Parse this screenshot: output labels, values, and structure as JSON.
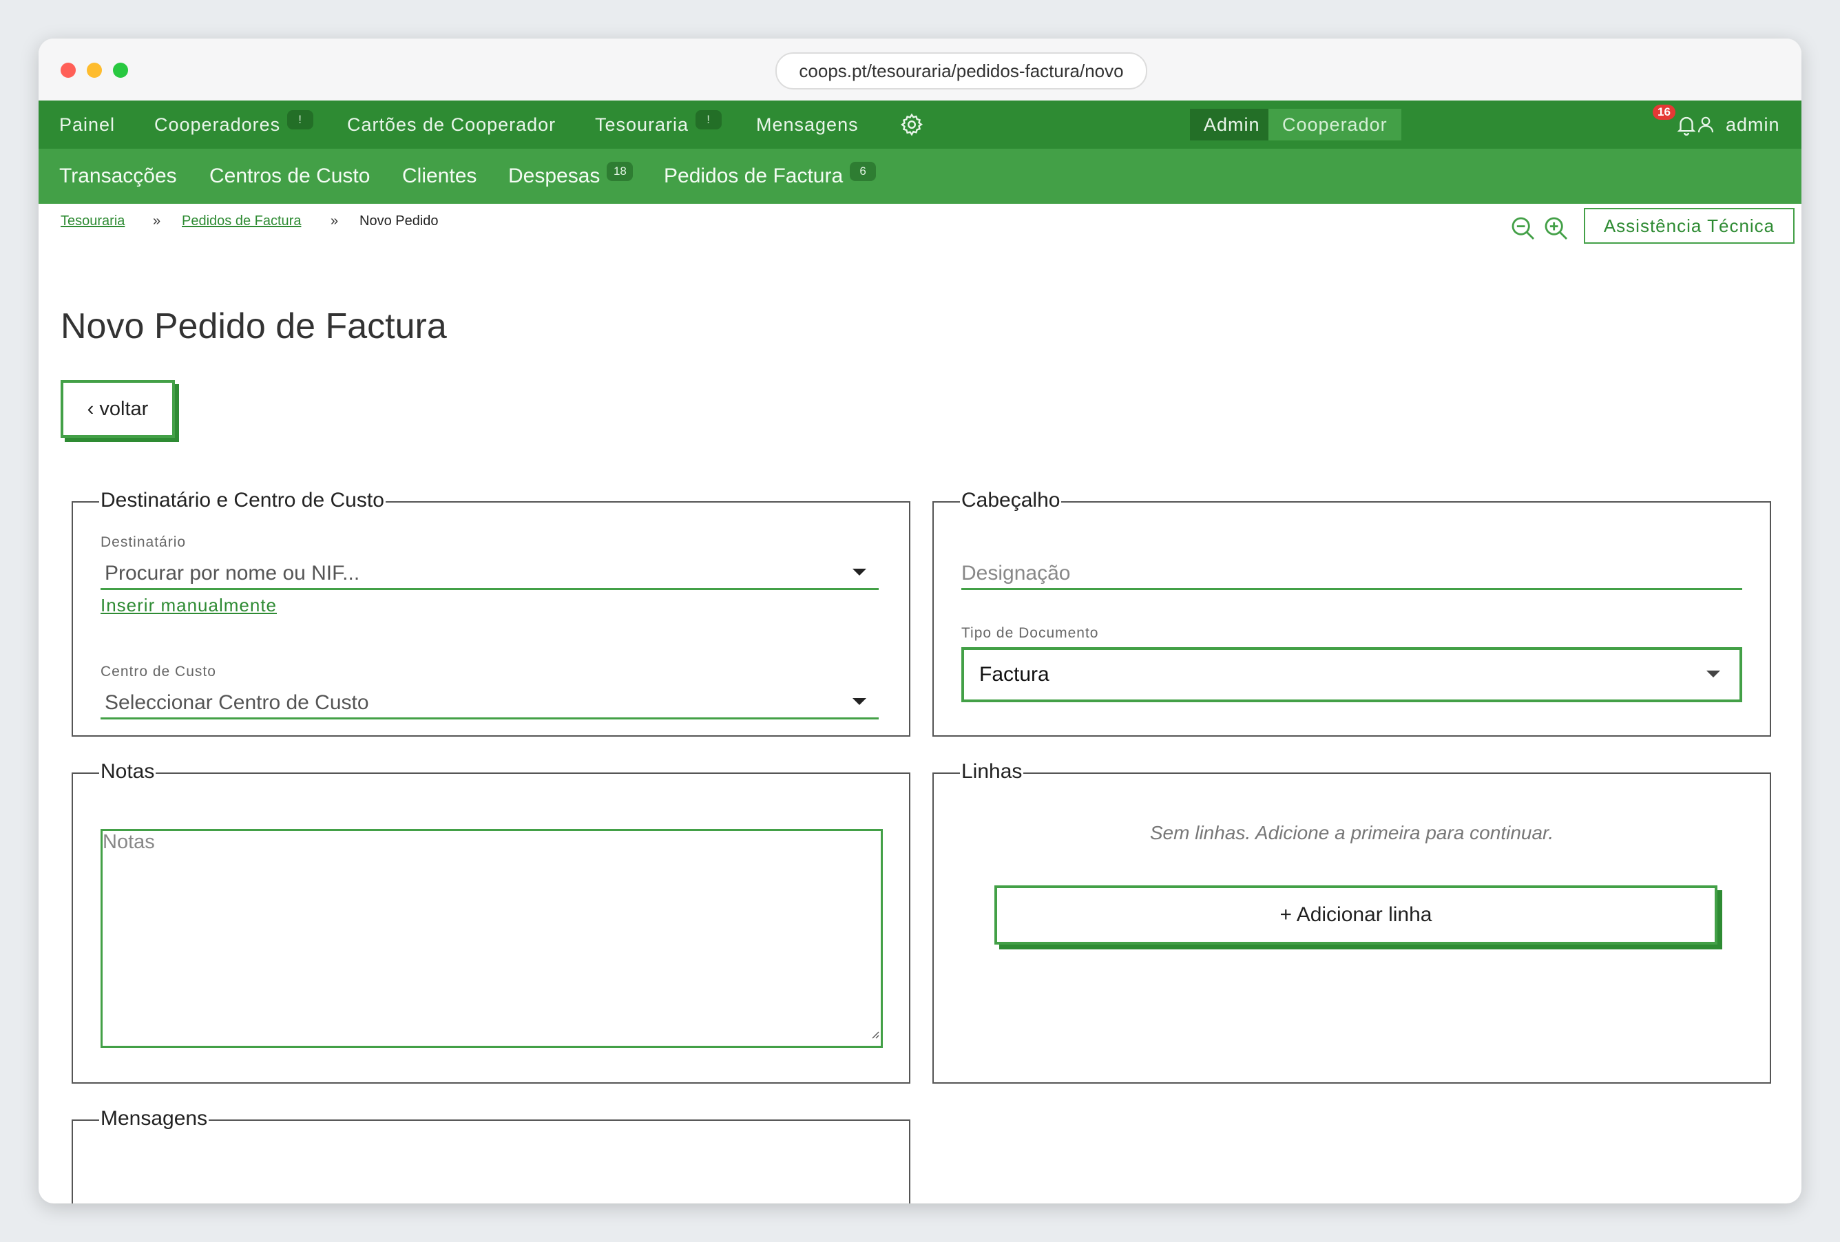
{
  "browser": {
    "url": "coops.pt/tesouraria/pedidos-factura/novo"
  },
  "topnav": {
    "items": [
      {
        "label": "Painel"
      },
      {
        "label": "Cooperadores",
        "badge": "!"
      },
      {
        "label": "Cartões de Cooperador"
      },
      {
        "label": "Tesouraria",
        "badge": "!"
      },
      {
        "label": "Mensagens"
      }
    ],
    "settings_icon": "gear-icon",
    "roles": [
      "Admin",
      "Cooperador"
    ],
    "active_role": "Admin",
    "notifications_count": "16",
    "user_label": "admin"
  },
  "subnav": {
    "items": [
      {
        "label": "Transacções"
      },
      {
        "label": "Centros de Custo"
      },
      {
        "label": "Clientes"
      },
      {
        "label": "Despesas",
        "badge": "18"
      },
      {
        "label": "Pedidos de Factura",
        "badge": "6"
      }
    ]
  },
  "breadcrumb": {
    "items": [
      "Tesouraria",
      "Pedidos de Factura",
      "Novo Pedido"
    ],
    "separator": "»"
  },
  "toolbar": {
    "zoom_out_icon": "zoom-out-icon",
    "zoom_in_icon": "zoom-in-icon",
    "assist_label": "Assistência Técnica"
  },
  "page": {
    "title": "Novo Pedido de Factura",
    "back_label": "‹ voltar"
  },
  "destinatario_panel": {
    "legend": "Destinatário e Centro de Custo",
    "recipient_label": "Destinatário",
    "recipient_placeholder": "Procurar por nome ou NIF...",
    "manual_link": "Inserir manualmente",
    "cost_center_label": "Centro de Custo",
    "cost_center_placeholder": "Seleccionar Centro de Custo"
  },
  "cabecalho_panel": {
    "legend": "Cabeçalho",
    "designation_placeholder": "Designação",
    "doc_type_label": "Tipo de Documento",
    "doc_type_value": "Factura"
  },
  "notas_panel": {
    "legend": "Notas",
    "placeholder": "Notas"
  },
  "linhas_panel": {
    "legend": "Linhas",
    "empty_message": "Sem linhas. Adicione a primeira para continuar.",
    "add_label": "+ Adicionar linha"
  },
  "mensagens_panel": {
    "legend": "Mensagens"
  },
  "colors": {
    "nav_dark": "#2e8b33",
    "nav_light": "#43a047",
    "accent": "#2e8b33",
    "badge_red": "#e53935"
  }
}
